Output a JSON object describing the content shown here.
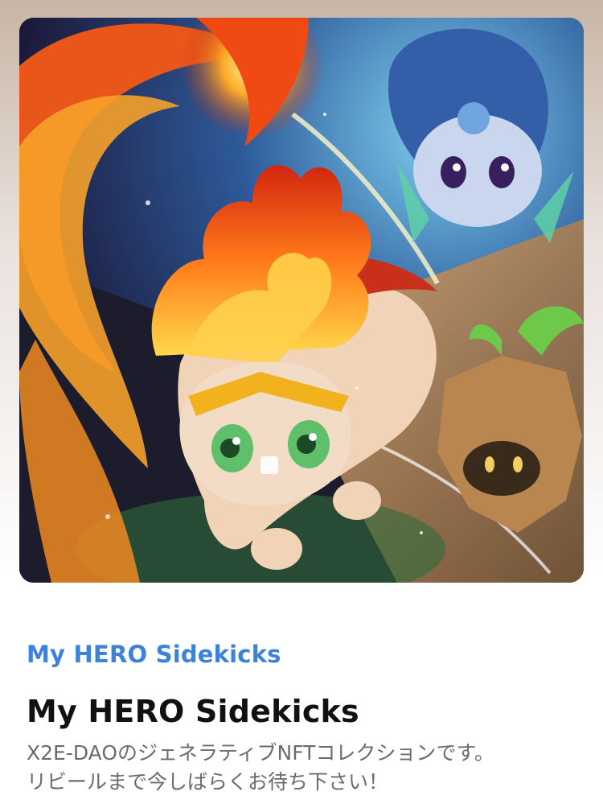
{
  "image": {
    "alt_icon": "nft-artwork-image"
  },
  "collection": {
    "link_label": "My HERO Sidekicks",
    "link_color": "#3c82d8"
  },
  "title": "My HERO Sidekicks",
  "description": {
    "line1": "X2E-DAOのジェネラティブNFTコレクションです。",
    "line2": "リビールまで今しばらくお待ち下さい！"
  }
}
